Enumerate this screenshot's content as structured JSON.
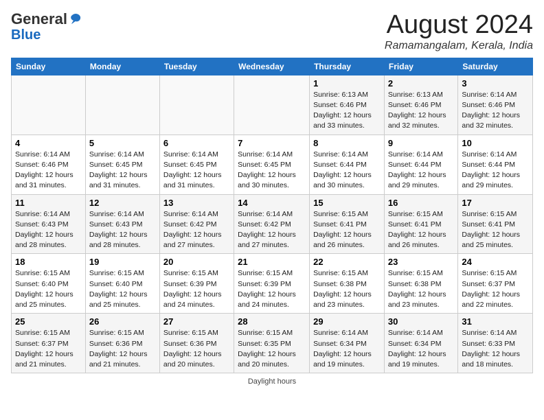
{
  "header": {
    "logo_general": "General",
    "logo_blue": "Blue",
    "month_title": "August 2024",
    "location": "Ramamangalam, Kerala, India"
  },
  "footer": {
    "daylight_label": "Daylight hours"
  },
  "days_of_week": [
    "Sunday",
    "Monday",
    "Tuesday",
    "Wednesday",
    "Thursday",
    "Friday",
    "Saturday"
  ],
  "weeks": [
    [
      {
        "day": "",
        "sunrise": "",
        "sunset": "",
        "daylight": ""
      },
      {
        "day": "",
        "sunrise": "",
        "sunset": "",
        "daylight": ""
      },
      {
        "day": "",
        "sunrise": "",
        "sunset": "",
        "daylight": ""
      },
      {
        "day": "",
        "sunrise": "",
        "sunset": "",
        "daylight": ""
      },
      {
        "day": "1",
        "sunrise": "Sunrise: 6:13 AM",
        "sunset": "Sunset: 6:46 PM",
        "daylight": "Daylight: 12 hours and 33 minutes."
      },
      {
        "day": "2",
        "sunrise": "Sunrise: 6:13 AM",
        "sunset": "Sunset: 6:46 PM",
        "daylight": "Daylight: 12 hours and 32 minutes."
      },
      {
        "day": "3",
        "sunrise": "Sunrise: 6:14 AM",
        "sunset": "Sunset: 6:46 PM",
        "daylight": "Daylight: 12 hours and 32 minutes."
      }
    ],
    [
      {
        "day": "4",
        "sunrise": "Sunrise: 6:14 AM",
        "sunset": "Sunset: 6:46 PM",
        "daylight": "Daylight: 12 hours and 31 minutes."
      },
      {
        "day": "5",
        "sunrise": "Sunrise: 6:14 AM",
        "sunset": "Sunset: 6:45 PM",
        "daylight": "Daylight: 12 hours and 31 minutes."
      },
      {
        "day": "6",
        "sunrise": "Sunrise: 6:14 AM",
        "sunset": "Sunset: 6:45 PM",
        "daylight": "Daylight: 12 hours and 31 minutes."
      },
      {
        "day": "7",
        "sunrise": "Sunrise: 6:14 AM",
        "sunset": "Sunset: 6:45 PM",
        "daylight": "Daylight: 12 hours and 30 minutes."
      },
      {
        "day": "8",
        "sunrise": "Sunrise: 6:14 AM",
        "sunset": "Sunset: 6:44 PM",
        "daylight": "Daylight: 12 hours and 30 minutes."
      },
      {
        "day": "9",
        "sunrise": "Sunrise: 6:14 AM",
        "sunset": "Sunset: 6:44 PM",
        "daylight": "Daylight: 12 hours and 29 minutes."
      },
      {
        "day": "10",
        "sunrise": "Sunrise: 6:14 AM",
        "sunset": "Sunset: 6:44 PM",
        "daylight": "Daylight: 12 hours and 29 minutes."
      }
    ],
    [
      {
        "day": "11",
        "sunrise": "Sunrise: 6:14 AM",
        "sunset": "Sunset: 6:43 PM",
        "daylight": "Daylight: 12 hours and 28 minutes."
      },
      {
        "day": "12",
        "sunrise": "Sunrise: 6:14 AM",
        "sunset": "Sunset: 6:43 PM",
        "daylight": "Daylight: 12 hours and 28 minutes."
      },
      {
        "day": "13",
        "sunrise": "Sunrise: 6:14 AM",
        "sunset": "Sunset: 6:42 PM",
        "daylight": "Daylight: 12 hours and 27 minutes."
      },
      {
        "day": "14",
        "sunrise": "Sunrise: 6:14 AM",
        "sunset": "Sunset: 6:42 PM",
        "daylight": "Daylight: 12 hours and 27 minutes."
      },
      {
        "day": "15",
        "sunrise": "Sunrise: 6:15 AM",
        "sunset": "Sunset: 6:41 PM",
        "daylight": "Daylight: 12 hours and 26 minutes."
      },
      {
        "day": "16",
        "sunrise": "Sunrise: 6:15 AM",
        "sunset": "Sunset: 6:41 PM",
        "daylight": "Daylight: 12 hours and 26 minutes."
      },
      {
        "day": "17",
        "sunrise": "Sunrise: 6:15 AM",
        "sunset": "Sunset: 6:41 PM",
        "daylight": "Daylight: 12 hours and 25 minutes."
      }
    ],
    [
      {
        "day": "18",
        "sunrise": "Sunrise: 6:15 AM",
        "sunset": "Sunset: 6:40 PM",
        "daylight": "Daylight: 12 hours and 25 minutes."
      },
      {
        "day": "19",
        "sunrise": "Sunrise: 6:15 AM",
        "sunset": "Sunset: 6:40 PM",
        "daylight": "Daylight: 12 hours and 25 minutes."
      },
      {
        "day": "20",
        "sunrise": "Sunrise: 6:15 AM",
        "sunset": "Sunset: 6:39 PM",
        "daylight": "Daylight: 12 hours and 24 minutes."
      },
      {
        "day": "21",
        "sunrise": "Sunrise: 6:15 AM",
        "sunset": "Sunset: 6:39 PM",
        "daylight": "Daylight: 12 hours and 24 minutes."
      },
      {
        "day": "22",
        "sunrise": "Sunrise: 6:15 AM",
        "sunset": "Sunset: 6:38 PM",
        "daylight": "Daylight: 12 hours and 23 minutes."
      },
      {
        "day": "23",
        "sunrise": "Sunrise: 6:15 AM",
        "sunset": "Sunset: 6:38 PM",
        "daylight": "Daylight: 12 hours and 23 minutes."
      },
      {
        "day": "24",
        "sunrise": "Sunrise: 6:15 AM",
        "sunset": "Sunset: 6:37 PM",
        "daylight": "Daylight: 12 hours and 22 minutes."
      }
    ],
    [
      {
        "day": "25",
        "sunrise": "Sunrise: 6:15 AM",
        "sunset": "Sunset: 6:37 PM",
        "daylight": "Daylight: 12 hours and 21 minutes."
      },
      {
        "day": "26",
        "sunrise": "Sunrise: 6:15 AM",
        "sunset": "Sunset: 6:36 PM",
        "daylight": "Daylight: 12 hours and 21 minutes."
      },
      {
        "day": "27",
        "sunrise": "Sunrise: 6:15 AM",
        "sunset": "Sunset: 6:36 PM",
        "daylight": "Daylight: 12 hours and 20 minutes."
      },
      {
        "day": "28",
        "sunrise": "Sunrise: 6:15 AM",
        "sunset": "Sunset: 6:35 PM",
        "daylight": "Daylight: 12 hours and 20 minutes."
      },
      {
        "day": "29",
        "sunrise": "Sunrise: 6:14 AM",
        "sunset": "Sunset: 6:34 PM",
        "daylight": "Daylight: 12 hours and 19 minutes."
      },
      {
        "day": "30",
        "sunrise": "Sunrise: 6:14 AM",
        "sunset": "Sunset: 6:34 PM",
        "daylight": "Daylight: 12 hours and 19 minutes."
      },
      {
        "day": "31",
        "sunrise": "Sunrise: 6:14 AM",
        "sunset": "Sunset: 6:33 PM",
        "daylight": "Daylight: 12 hours and 18 minutes."
      }
    ]
  ]
}
